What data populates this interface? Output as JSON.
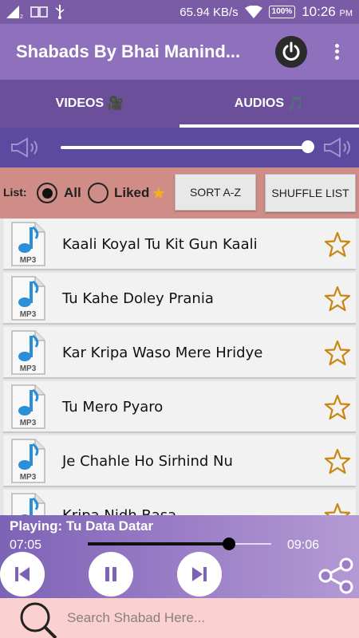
{
  "status_bar": {
    "network_speed": "65.94 KB/s",
    "battery": "100%",
    "time": "10:26",
    "ampm": "PM"
  },
  "app_bar": {
    "title": "Shabads By Bhai Manind..."
  },
  "tabs": [
    {
      "label": "VIDEOS",
      "icon": "🎥",
      "active": false
    },
    {
      "label": "AUDIOS",
      "icon": "🎵",
      "active": true
    }
  ],
  "volume": {
    "level": 1.0
  },
  "list_controls": {
    "label": "List:",
    "options": [
      {
        "label": "All",
        "selected": true
      },
      {
        "label": "Liked",
        "selected": false
      }
    ],
    "liked_star": "★",
    "sort_button": "SORT A-Z",
    "shuffle_button": "SHUFFLE LIST"
  },
  "songs": [
    {
      "title": "Kaali Koyal Tu Kit Gun Kaali",
      "liked": false
    },
    {
      "title": "Tu Kahe Doley Prania",
      "liked": false
    },
    {
      "title": "Kar Kripa Waso Mere Hridye",
      "liked": false
    },
    {
      "title": "Tu Mero Pyaro",
      "liked": false
    },
    {
      "title": "Je Chahle Ho Sirhind Nu",
      "liked": false
    },
    {
      "title": "Kripa Nidh Basa",
      "liked": false
    }
  ],
  "player": {
    "now_playing": "Playing: Tu Data Datar",
    "current_time": "07:05",
    "total_time": "09:06",
    "progress": 0.77
  },
  "search": {
    "placeholder": "Search Shabad Here..."
  },
  "colors": {
    "status_bar": "#7a5ba6",
    "app_bar": "#8f70bd",
    "tabs": "#6b4f9a",
    "volume_bar": "#5a4aa0",
    "list_controls": "#d08d88",
    "search_bar": "#fbd0d0",
    "star": "#c9860f"
  }
}
